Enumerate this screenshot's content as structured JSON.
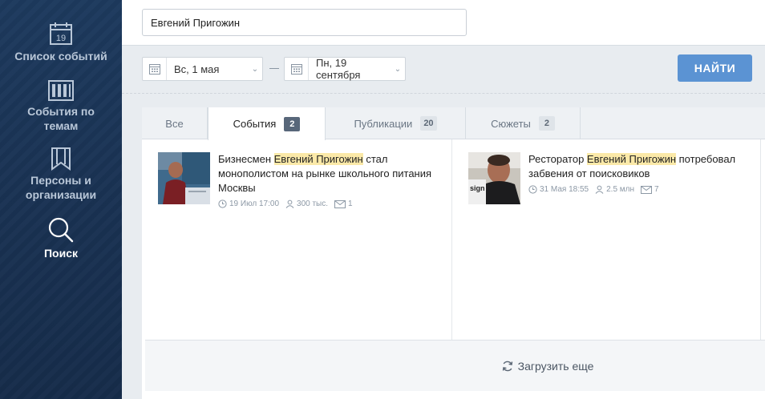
{
  "sidebar": {
    "items": [
      {
        "label": "Список событий",
        "icon": "calendar-icon",
        "badge": "19",
        "active": false
      },
      {
        "label": "События по темам",
        "icon": "columns-icon",
        "active": false
      },
      {
        "label": "Персоны и организации",
        "icon": "bookmarks-icon",
        "active": false
      },
      {
        "label": "Поиск",
        "icon": "search-icon",
        "active": true
      }
    ]
  },
  "search": {
    "value": "Евгений Пригожин",
    "placeholder": ""
  },
  "filters": {
    "date_from": "Вс, 1 мая",
    "date_to": "Пн, 19 сентября",
    "find_label": "НАЙТИ"
  },
  "tabs": [
    {
      "label": "Все",
      "count": ""
    },
    {
      "label": "События",
      "count": "2",
      "active": true
    },
    {
      "label": "Публикации",
      "count": "20"
    },
    {
      "label": "Сюжеты",
      "count": "2"
    }
  ],
  "results": [
    {
      "title_before": "Бизнесмен ",
      "title_highlight": "Евгений Пригожин",
      "title_after": " стал монополистом на рынке школьного питания Москвы",
      "time": "19 Июл 17:00",
      "audience": "300 тыс.",
      "messages": "1"
    },
    {
      "title_before": "Ресторатор ",
      "title_highlight": "Евгений Пригожин",
      "title_after": " потребовал забвения от поисковиков",
      "time": "31 Мая 18:55",
      "audience": "2.5 млн",
      "messages": "7"
    }
  ],
  "load_more_label": "Загрузить еще",
  "colors": {
    "accent": "#5b93d3",
    "highlight": "#fbe9a8",
    "sidebar": "#1a3354"
  }
}
